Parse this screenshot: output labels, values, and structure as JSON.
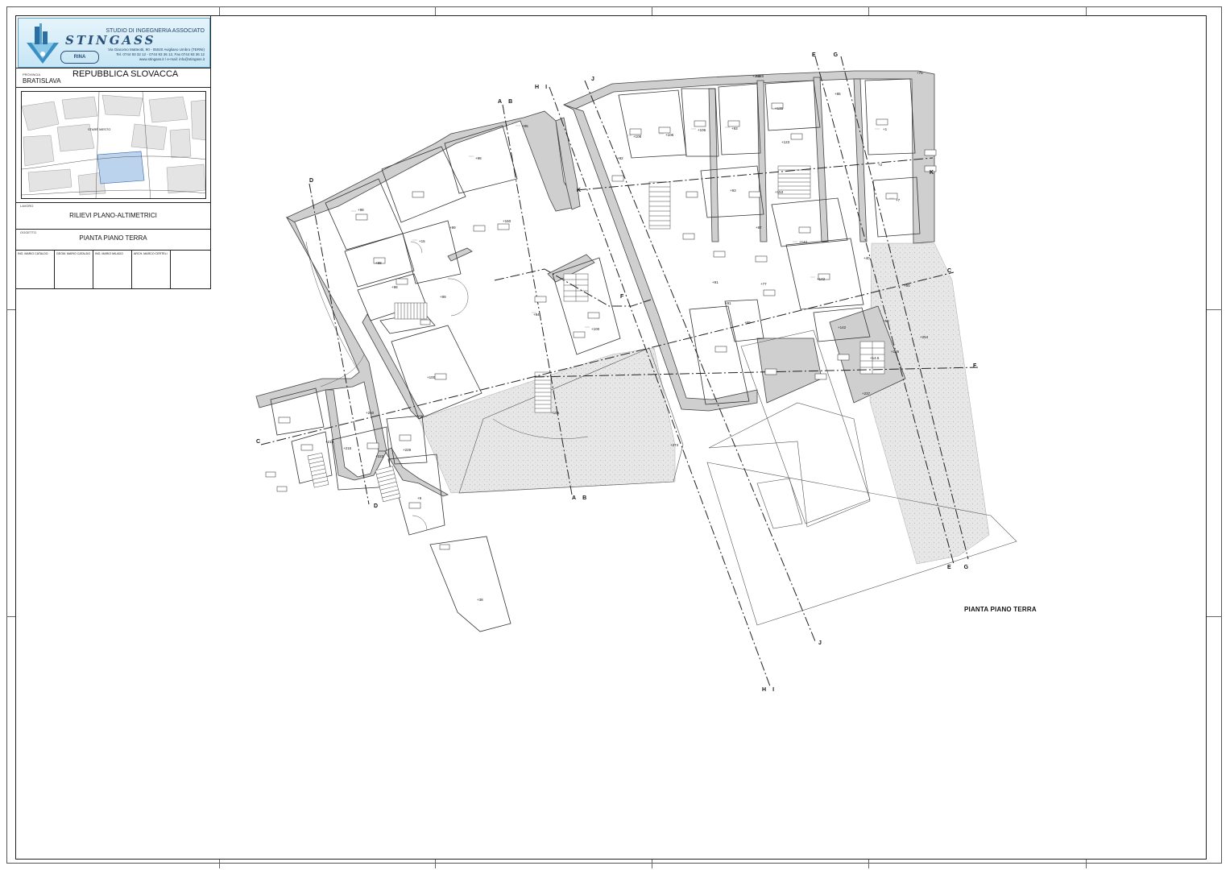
{
  "title_block": {
    "firm_logo_text": "STINGASS",
    "studio_name": "STUDIO DI INGEGNERIA ASSOCIATO",
    "address_line1": "Via Giacomo Matteotti, 90 - 05020 Avigliano Umbro (TERNI)",
    "address_line2": "Tel. 0744 93 32 12 - 0744 93 36 12, Fax 0744 93 36 12",
    "address_line3": "www.stingass.it / e-mail: info@stingass.it",
    "certification_badge": "RINA",
    "provincia_label": "PROVINCIA",
    "provincia_value": "BRATISLAVA",
    "country": "REPUBBLICA SLOVACCA",
    "map_label": "STARÉ MESTO",
    "lavoro_label": "LAVORO",
    "lavoro_value": "RILIEVI PLANO-ALTIMETRICI",
    "oggetto_label": "OGGETTO",
    "oggetto_value": "PIANTA PIANO TERRA",
    "signatures": [
      "ING. MARIO CATALDO",
      "GEOM. MARIO CATALDO",
      "ING. MARIO MILADO",
      "ARCH. MARCO CERTELI",
      ""
    ]
  },
  "drawing": {
    "plan_title": "PIANTA PIANO TERRA",
    "section_markers": [
      {
        "id": "A-B-top",
        "label_a": "A",
        "label_b": "B"
      },
      {
        "id": "A-B-bottom",
        "label_a": "A",
        "label_b": "B"
      },
      {
        "id": "H-I-top",
        "label_a": "H",
        "label_b": "I"
      },
      {
        "id": "H-I-bottom",
        "label_a": "H",
        "label_b": "I"
      },
      {
        "id": "J-top",
        "label_a": "J"
      },
      {
        "id": "J-bottom",
        "label_a": "J"
      },
      {
        "id": "E-G-top",
        "label_a": "E",
        "label_b": "G"
      },
      {
        "id": "E-G-bottom",
        "label_a": "E",
        "label_b": "G"
      },
      {
        "id": "D-top",
        "label_a": "D"
      },
      {
        "id": "D-bottom",
        "label_a": "D"
      },
      {
        "id": "C-left",
        "label_a": "C"
      },
      {
        "id": "C-right",
        "label_a": "C"
      },
      {
        "id": "F-mid",
        "label_a": "F"
      },
      {
        "id": "F-right",
        "label_a": "F"
      },
      {
        "id": "K-left",
        "label_a": "K"
      },
      {
        "id": "K-right",
        "label_a": "K"
      }
    ],
    "level_labels": [
      "+98",
      "+95",
      "+98",
      "+15",
      "+99",
      "+98",
      "+98",
      "+160",
      "+99",
      "+100",
      "+240",
      "+215",
      "+215",
      "+223",
      "+229",
      "+9",
      "+38",
      "+94",
      "+106",
      "+100",
      "+108",
      "+106",
      "+106",
      "+93",
      "+159",
      "+93",
      "+82",
      "+87",
      "+153",
      "+77",
      "+91",
      "+91",
      "+142",
      "+142",
      "+40",
      "+50",
      "+142",
      "+50",
      "+126",
      "+14.5",
      "+237",
      "+274",
      "+60",
      "+254",
      "+1",
      "+2",
      "+7",
      "+120",
      "+75",
      "+85",
      "+131",
      "+123"
    ]
  }
}
